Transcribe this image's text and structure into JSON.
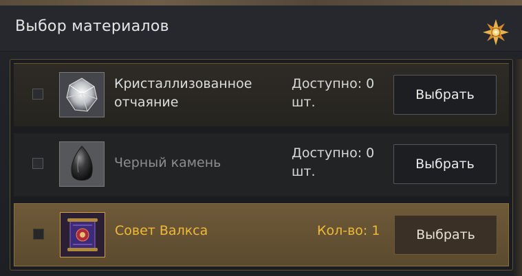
{
  "window": {
    "title": "Выбор материалов",
    "emblem_icon": "star-emblem-icon"
  },
  "colors": {
    "accent_gold": "#f0b93a",
    "selected_row": "#6e5a38",
    "panel_bg": "#1d1f23"
  },
  "materials": [
    {
      "name": "Кристаллизованное отчаяние",
      "icon": "crystal-icon",
      "status_text": "Доступно: 0 шт.",
      "button_label": "Выбрать",
      "checked": false
    },
    {
      "name": "Черный камень",
      "icon": "black-stone-icon",
      "status_text": "Доступно: 0 шт.",
      "button_label": "Выбрать",
      "checked": false
    },
    {
      "name": "Совет Валкса",
      "icon": "valks-scroll-icon",
      "status_text": "Кол-во: 1",
      "button_label": "Выбрать",
      "checked": false,
      "selected": true
    }
  ]
}
